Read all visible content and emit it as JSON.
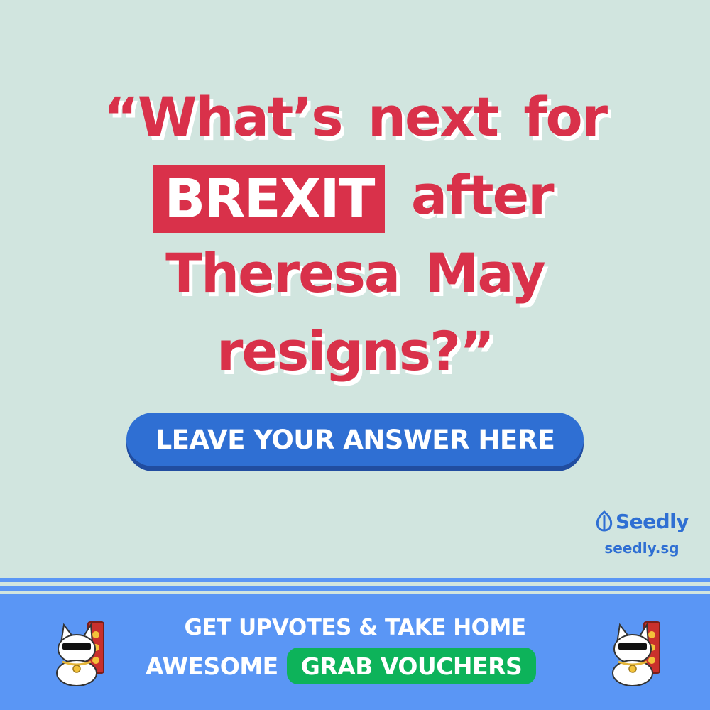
{
  "headline": {
    "line1": [
      "“What’s",
      "next",
      "for"
    ],
    "line2_highlight": "BREXIT",
    "line2_rest": "after",
    "line3": [
      "Theresa",
      "May"
    ],
    "line4": "resigns?”"
  },
  "cta": {
    "label": "LEAVE YOUR ANSWER HERE"
  },
  "brand": {
    "logo_text": "Seedly",
    "url": "seedly.sg",
    "logo_icon": "seedly-leaf-icon"
  },
  "footer": {
    "line1": "GET UPVOTES & TAKE HOME",
    "line2_prefix": "AWESOME",
    "grab_button": "GRAB VOUCHERS",
    "mascot_icon": "lucky-cat-with-sunglasses-icon"
  },
  "colors": {
    "background": "#d1e5df",
    "headline_red": "#d9314a",
    "brand_blue": "#2f6fd3",
    "banner_blue": "#5a96f5",
    "voucher_green": "#0db35a"
  }
}
